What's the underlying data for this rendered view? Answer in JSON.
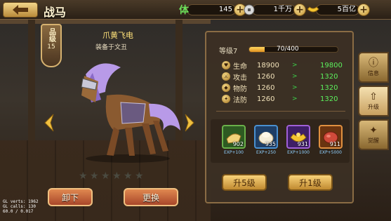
{
  "header": {
    "title": "战马",
    "stamina": {
      "icon_label": "体",
      "value": "145"
    },
    "coins": {
      "value": "1千万"
    },
    "gold": {
      "value": "5百亿"
    }
  },
  "horse": {
    "name": "爪黄飞电",
    "equipped_by": "装备于文丑",
    "grade_label": "品级",
    "grade_value": "15",
    "stars_total": 6,
    "stars_filled": 0
  },
  "actions": {
    "unequip": "卸下",
    "replace": "更换"
  },
  "debug": [
    "GL verts:   1962",
    "GL calls:    130",
    "60.0 / 0.017"
  ],
  "panel": {
    "level_label": "等级7",
    "xp_text": "70/400",
    "xp_fraction": 0.175,
    "stats": [
      {
        "icon": "heart-icon",
        "name": "生命",
        "current": "18900",
        "next": "19800"
      },
      {
        "icon": "sword-icon",
        "name": "攻击",
        "current": "1260",
        "next": "1320"
      },
      {
        "icon": "shield-icon",
        "name": "物防",
        "current": "1260",
        "next": "1320"
      },
      {
        "icon": "magic-icon",
        "name": "法防",
        "current": "1260",
        "next": "1320"
      }
    ],
    "stat_arrow": ">",
    "items": [
      {
        "icon": "bread-icon",
        "count": "902",
        "exp": "EXP+100",
        "border": "#6ab04a",
        "bg": "#2e5a22"
      },
      {
        "icon": "bun-icon",
        "count": "935",
        "exp": "EXP+250",
        "border": "#4a90d0",
        "bg": "#1e3e66"
      },
      {
        "icon": "gold-ingot-icon",
        "count": "931",
        "exp": "EXP+1000",
        "border": "#a060d8",
        "bg": "#3e1e66"
      },
      {
        "icon": "meat-icon",
        "count": "911",
        "exp": "EXP+5000",
        "border": "#e09040",
        "bg": "#6a3410"
      }
    ],
    "upgrade5": "升5级",
    "upgrade1": "升1级"
  },
  "side_tabs": [
    {
      "icon": "info-icon",
      "glyph": "ⓘ",
      "label": "信息"
    },
    {
      "icon": "upgrade-icon",
      "glyph": "⇧",
      "label": "升级"
    },
    {
      "icon": "awaken-icon",
      "glyph": "✦",
      "label": "觉醒"
    }
  ],
  "colors": {
    "stat_up": "#5cf05c",
    "gold_button": "#e8b850",
    "red_button": "#c0603a"
  }
}
